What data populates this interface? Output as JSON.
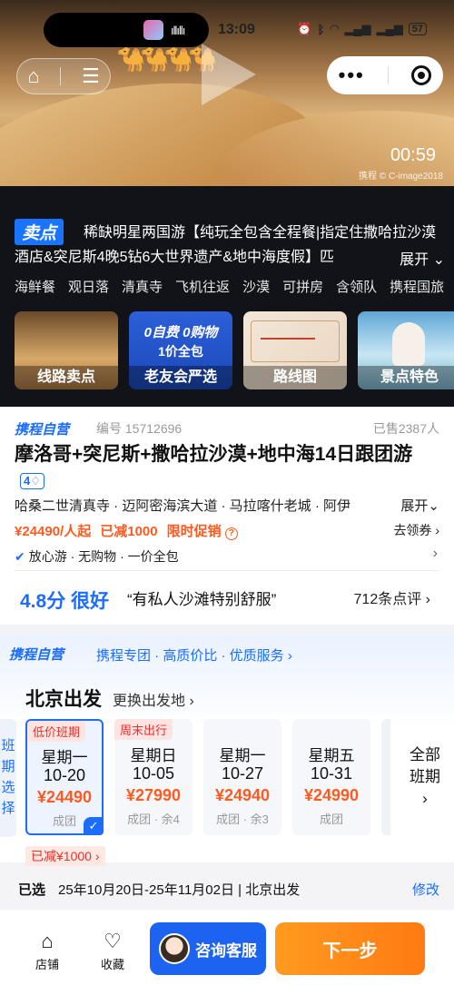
{
  "status": {
    "time": "13:09",
    "battery": "57"
  },
  "hero": {
    "duration": "00:59",
    "credit": "携程 © C-image2018"
  },
  "sell": {
    "tag": "卖点",
    "title": "稀缺明星两国游【纯玩全包含全程餐|指定住撒哈拉沙漠酒店&突尼斯4晚5钻6大世界遗产&地中海度假】匹",
    "expand": "展开",
    "tags": [
      "海鲜餐",
      "观日落",
      "清真寺",
      "飞机往返",
      "沙漠",
      "可拼房",
      "含领队",
      "携程国旅"
    ],
    "cards": [
      {
        "label": "线路卖点"
      },
      {
        "label": "老友会严选",
        "top": "0自费 0购物",
        "mid": "1价全包"
      },
      {
        "label": "路线图"
      },
      {
        "label": "景点特色"
      }
    ]
  },
  "product": {
    "badge": "携程自营",
    "id": "编号 15712696",
    "sold": "已售2387人",
    "title": "摩洛哥+突尼斯+撒哈拉沙漠+地中海14日跟团游",
    "level": "4",
    "route": "哈桑二世清真寺 · 迈阿密海滨大道 · 马拉喀什老城 · 阿伊",
    "route_expand": "展开",
    "price": "¥24490/人起",
    "discount": "已减1000",
    "promo": "限时促销",
    "coupon": "去领券",
    "assurance": "放心游 · 无购物 · 一价全包",
    "score": "4.8分 很好",
    "quote": "“有私人沙滩特别舒服”",
    "reviews": "712条点评"
  },
  "departure": {
    "badge": "携程自营",
    "slogan": "携程专团 · 高质价比 · 优质服务",
    "city": "北京出发",
    "change": "更换出发地",
    "side_label": "班期选择",
    "dates": [
      {
        "badge": "低价班期",
        "weekday": "星期一",
        "date": "10-20",
        "price": "¥24490",
        "status": "成团",
        "selected": true
      },
      {
        "badge": "周末出行",
        "weekday": "星期日",
        "date": "10-05",
        "price": "¥27990",
        "status": "成团 · 余4"
      },
      {
        "badge": "",
        "weekday": "星期一",
        "date": "10-27",
        "price": "¥24940",
        "status": "成团 · 余3"
      },
      {
        "badge": "",
        "weekday": "星期五",
        "date": "10-31",
        "price": "¥24990",
        "status": "成团"
      }
    ],
    "all_dates": "全部班期",
    "saved": "已减¥1000"
  },
  "selection": {
    "key": "已选",
    "value": "25年10月20日-25年11月02日 | 北京出发",
    "modify": "修改"
  },
  "bottom": {
    "store": "店铺",
    "favorite": "收藏",
    "consult": "咨询客服",
    "next": "下一步"
  }
}
